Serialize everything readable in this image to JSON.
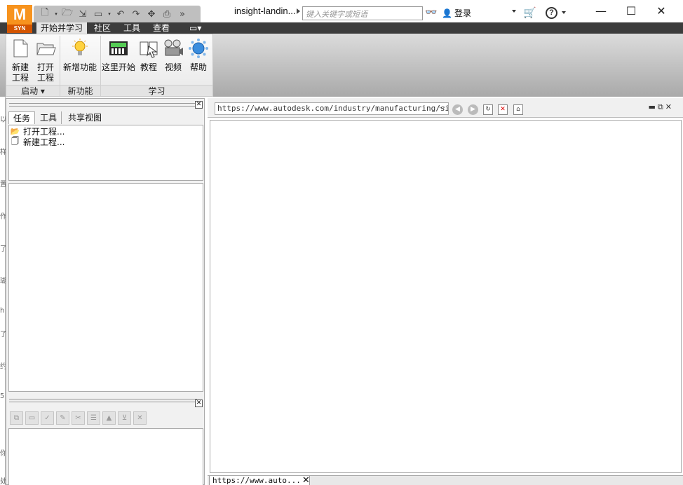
{
  "app": {
    "logo_letter": "M",
    "logo_sub": "SYN"
  },
  "title": {
    "document": "insight-landin..."
  },
  "search": {
    "placeholder": "键入关键字或短语"
  },
  "account": {
    "signin_label": "登录"
  },
  "window": {
    "minimize": "—",
    "maximize": "☐",
    "close": "✕"
  },
  "ribbon": {
    "tabs": [
      "开始并学习",
      "社区",
      "工具",
      "查看"
    ],
    "active_tab": "开始并学习",
    "groups": [
      {
        "label": "启动 ▾",
        "buttons": [
          {
            "label": "新建\n工程",
            "icon": "new-project-icon"
          },
          {
            "label": "打开\n工程",
            "icon": "open-project-icon"
          }
        ]
      },
      {
        "label": "新功能",
        "buttons": [
          {
            "label": "新增功能",
            "icon": "lightbulb-icon"
          }
        ]
      },
      {
        "label": "学习",
        "buttons": [
          {
            "label": "这里开始",
            "icon": "start-here-icon"
          },
          {
            "label": "教程",
            "icon": "tutorial-icon"
          },
          {
            "label": "视频",
            "icon": "video-icon"
          },
          {
            "label": "帮助",
            "icon": "help-globe-icon"
          }
        ]
      }
    ]
  },
  "left_panel": {
    "tabs": [
      "任务",
      "工具",
      "共享视图"
    ],
    "active_tab": "任务",
    "tasks": [
      {
        "label": "打开工程...",
        "icon": "folder-open-icon"
      },
      {
        "label": "新建工程...",
        "icon": "new-file-icon"
      }
    ],
    "left_strip_chars": [
      "以",
      "样",
      "置",
      "作",
      "了",
      "瑚",
      "h",
      "了",
      "约",
      "5",
      "你",
      "处"
    ]
  },
  "browser": {
    "url": "https://www.autodesk.com/industry/manufacturing/simulat",
    "tab_label": "https://www.auto..."
  },
  "colors": {
    "accent_orange": "#f7931e",
    "tab_bar": "#3c3c3c"
  }
}
